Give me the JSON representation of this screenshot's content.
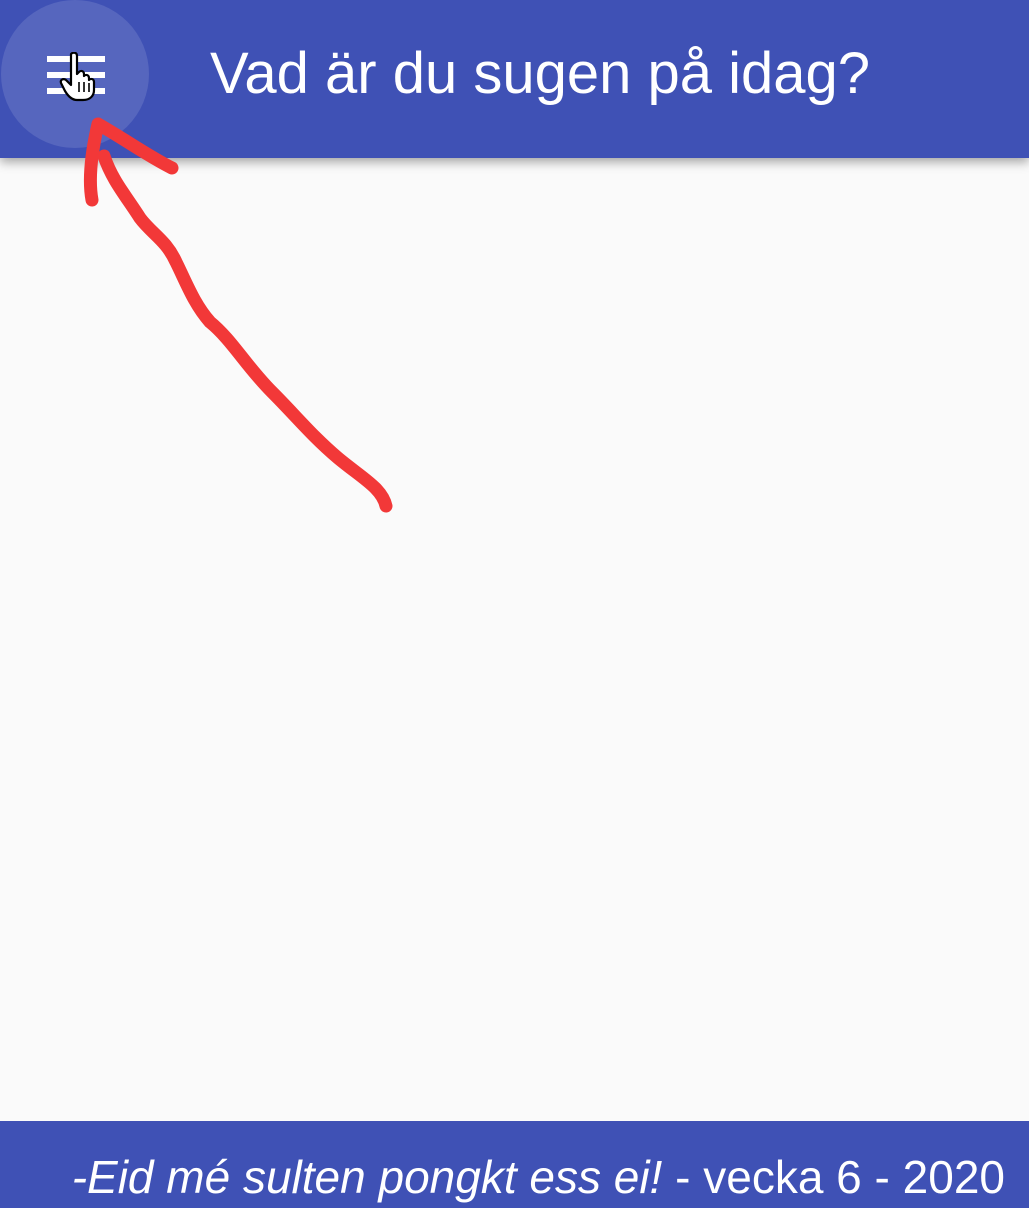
{
  "app_bar": {
    "title": "Vad är du sugen på idag?",
    "menu_icon": "menu-icon",
    "background_color": "#3f51b5",
    "title_color": "#ffffff"
  },
  "annotation": {
    "icon": "arrow-icon",
    "color": "#f23838"
  },
  "footer": {
    "motto": "-Eid mé sulten pongkt ess ei!",
    "separator_1": " - ",
    "week": "vecka 6",
    "separator_2": " - ",
    "year": "2020",
    "background_color": "#3f51b5"
  }
}
